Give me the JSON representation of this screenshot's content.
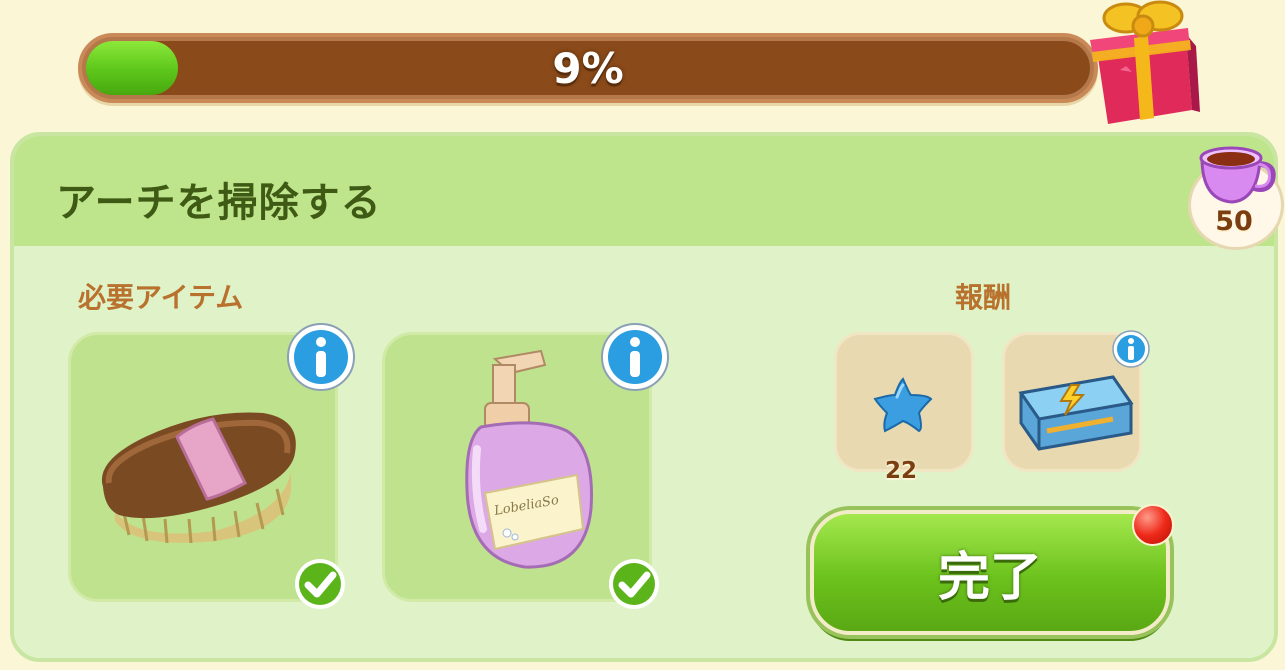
{
  "progress": {
    "percent_label": "9%",
    "value": 0.09
  },
  "task": {
    "title": "アーチを掃除する",
    "cost": "50",
    "cost_icon": "teacup-icon"
  },
  "required": {
    "label": "必要アイテム",
    "items": [
      {
        "name": "brush",
        "icon": "brush-icon",
        "owned": true
      },
      {
        "name": "soap",
        "icon": "soap-bottle-icon",
        "bottle_text": "LobeliaSo",
        "owned": true
      }
    ]
  },
  "rewards": {
    "label": "報酬",
    "items": [
      {
        "icon": "blue-star-icon",
        "count": "22"
      },
      {
        "icon": "energy-chest-icon"
      }
    ]
  },
  "actions": {
    "complete_label": "完了"
  },
  "colors": {
    "accent_green": "#6cc21c",
    "header_green": "#bfe58c",
    "label_orange": "#b8722e",
    "bar_brown": "#8a4a1a"
  }
}
